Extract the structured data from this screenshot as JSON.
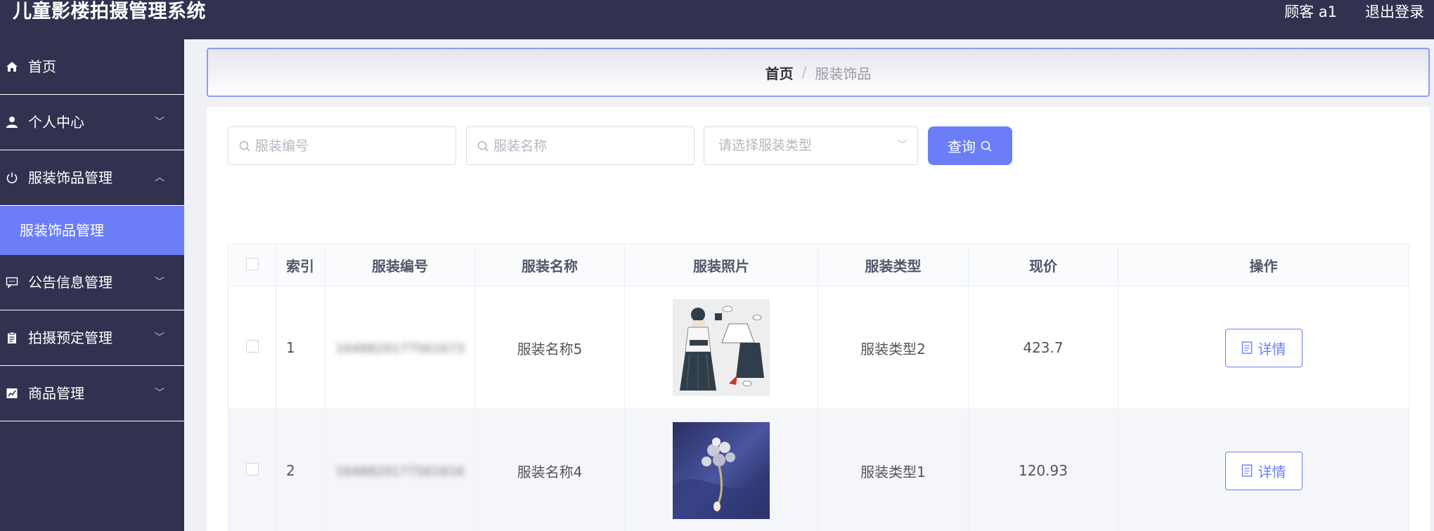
{
  "app": {
    "title": "儿童影楼拍摄管理系统",
    "user": "顾客 a1",
    "logout": "退出登录"
  },
  "sidebar": {
    "items": [
      {
        "label": "首页",
        "icon": "home-icon",
        "arrow": ""
      },
      {
        "label": "个人中心",
        "icon": "user-icon",
        "arrow": "﹀"
      },
      {
        "label": "服装饰品管理",
        "icon": "power-icon",
        "arrow": "︿"
      },
      {
        "label": "公告信息管理",
        "icon": "message-icon",
        "arrow": "﹀"
      },
      {
        "label": "拍摄预定管理",
        "icon": "clipboard-icon",
        "arrow": "﹀"
      },
      {
        "label": "商品管理",
        "icon": "chart-icon",
        "arrow": "﹀"
      }
    ],
    "active_sub": "服装饰品管理"
  },
  "breadcrumb": {
    "home": "首页",
    "separator": "/",
    "current": "服装饰品"
  },
  "search": {
    "code_placeholder": "服装编号",
    "name_placeholder": "服装名称",
    "type_placeholder": "请选择服装类型",
    "query_label": "查询"
  },
  "table": {
    "headers": [
      "索引",
      "服装编号",
      "服装名称",
      "服装照片",
      "服装类型",
      "现价",
      "操作"
    ],
    "rows": [
      {
        "index": "1",
        "code": "1648820177561673",
        "name": "服装名称5",
        "photo": "hanfu-outfit-illustration",
        "type": "服装类型2",
        "price": "423.7",
        "action": "详情"
      },
      {
        "index": "2",
        "code": "1648820177561616",
        "name": "服装名称4",
        "photo": "flower-brooch-on-blue-silk",
        "type": "服装类型1",
        "price": "120.93",
        "action": "详情"
      }
    ]
  },
  "colors": {
    "sidebar_bg": "#30324f",
    "accent": "#6b7ef8"
  }
}
